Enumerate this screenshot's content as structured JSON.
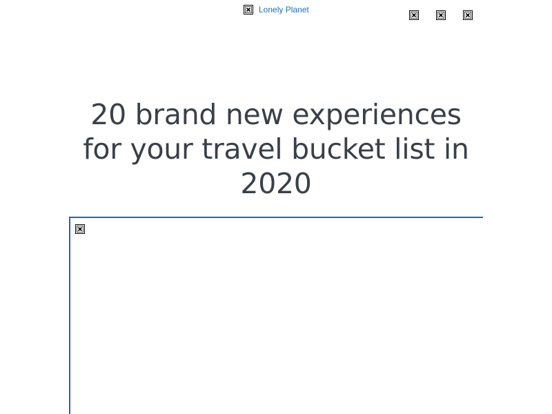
{
  "header": {
    "logo_icon": "broken-image-icon",
    "logo_text": "Lonely Planet",
    "icons": [
      "broken-image-icon",
      "broken-image-icon",
      "broken-image-icon"
    ]
  },
  "article": {
    "title": "20 brand new experiences for your travel bucket list in 2020",
    "hero_image_icon": "broken-image-icon"
  },
  "colors": {
    "link": "#1c6fb5",
    "title": "#3a4049",
    "frame_border": "#1a6aa8"
  }
}
